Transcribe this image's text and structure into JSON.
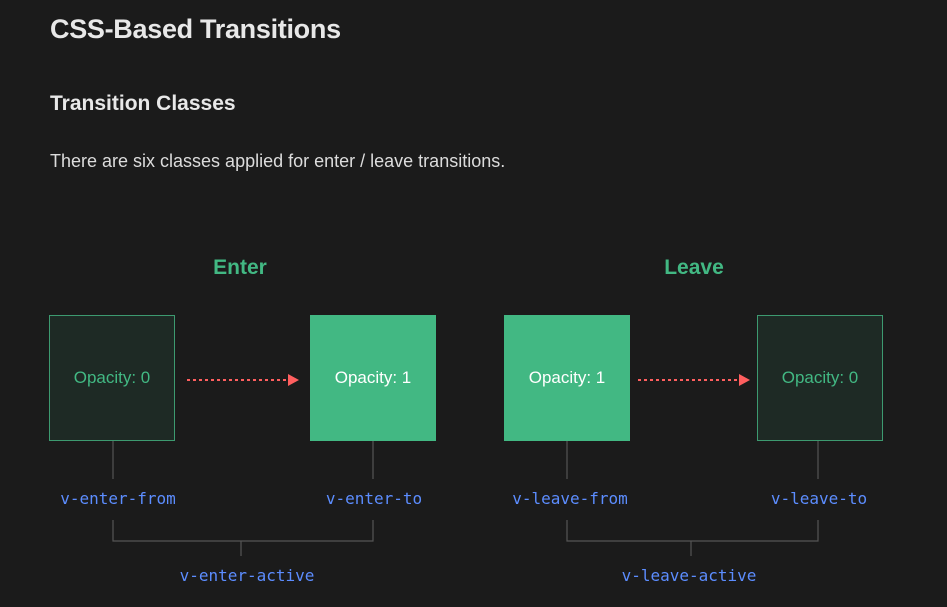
{
  "heading": "CSS-Based Transitions",
  "subheading": "Transition Classes",
  "paragraph": "There are six classes applied for enter / leave transitions.",
  "colors": {
    "accent_green": "#42b883",
    "arrow_red": "#ff5f5f",
    "code_blue": "#5c8dff",
    "background": "#1b1b1b"
  },
  "enter": {
    "title": "Enter",
    "from_box": "Opacity: 0",
    "to_box": "Opacity: 1",
    "from_class": "v-enter-from",
    "to_class": "v-enter-to",
    "active_class": "v-enter-active"
  },
  "leave": {
    "title": "Leave",
    "from_box": "Opacity: 1",
    "to_box": "Opacity: 0",
    "from_class": "v-leave-from",
    "to_class": "v-leave-to",
    "active_class": "v-leave-active"
  }
}
